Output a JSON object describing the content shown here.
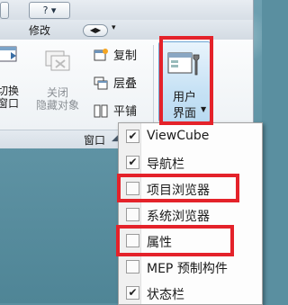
{
  "ribbon": {
    "qat": {
      "help_label": "?"
    },
    "tabs": {
      "modify_label": "修改",
      "dropdown_glyph": "▾"
    },
    "window_panel": {
      "switch_label": "切换",
      "switch_label_line2": "窗口",
      "close_label": "关闭",
      "close_label_line2": "隐藏对象",
      "copy_label": "复制",
      "cascade_label": "层叠",
      "tile_label": "平铺",
      "user_interface_label_line1": "用户",
      "user_interface_label_line2": "界面",
      "panel_title": "窗口"
    }
  },
  "menu": {
    "items": [
      {
        "label": "ViewCube",
        "checked": true
      },
      {
        "label": "导航栏",
        "checked": true
      },
      {
        "label": "项目浏览器",
        "checked": false
      },
      {
        "label": "系统浏览器",
        "checked": false
      },
      {
        "label": "属性",
        "checked": false
      },
      {
        "label": "MEP 预制构件",
        "checked": false
      },
      {
        "label": "状态栏",
        "checked": true
      }
    ]
  },
  "colors": {
    "highlight": "#e4222a",
    "ui_button_bg": "#c7e2f5"
  }
}
